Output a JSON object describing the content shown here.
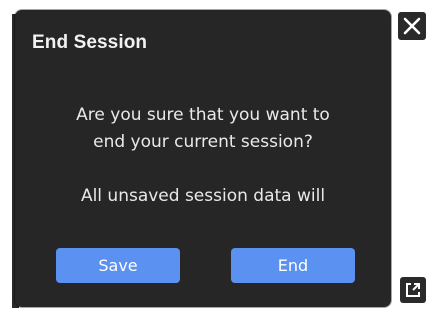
{
  "dialog": {
    "title": "End Session",
    "message_lines": [
      "Are you sure that you want to",
      "end your current session?"
    ],
    "note": "All unsaved session data will",
    "buttons": {
      "save_label": "Save",
      "end_label": "End"
    }
  },
  "icons": {
    "close": "close-icon",
    "expand": "expand-icon"
  },
  "colors": {
    "dialog_bg": "#262626",
    "button_bg": "#5b91f0",
    "text": "#e9e9e9"
  }
}
